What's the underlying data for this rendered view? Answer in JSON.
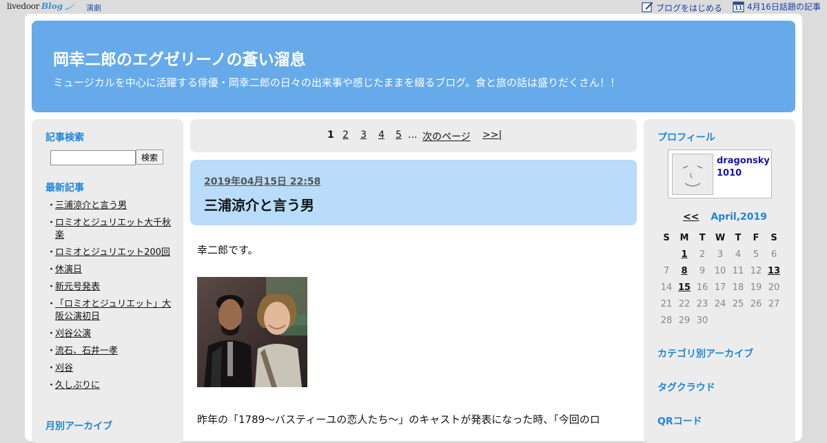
{
  "topbar": {
    "logo_text": "livedoor",
    "logo_blog": "Blog",
    "category": "演劇",
    "start_blog": "ブログをはじめる",
    "trending": "4月16日話題の記事",
    "calendar_icon_day": "11"
  },
  "header": {
    "title": "岡幸二郎のエグゼリーノの蒼い溜息",
    "subtitle": "ミュージカルを中心に活躍する俳優・岡幸二郎の日々の出来事や感じたままを綴るブログ。食と旅の話は盛りだくさん！！"
  },
  "sidebar_left": {
    "search_heading": "記事検索",
    "search_value": "",
    "search_button": "検索",
    "recent_heading": "最新記事",
    "recent": [
      {
        "label": "三浦涼介と言う男"
      },
      {
        "label": "ロミオとジュリエット大千秋楽"
      },
      {
        "label": "ロミオとジュリエット200回"
      },
      {
        "label": "休演日"
      },
      {
        "label": "新元号発表"
      },
      {
        "label": "「ロミオとジュリエット」大阪公演初日"
      },
      {
        "label": "刈谷公演"
      },
      {
        "label": "流石、石井一孝"
      },
      {
        "label": "刈谷"
      },
      {
        "label": "久しぶりに"
      }
    ],
    "monthly_heading": "月別アーカイブ"
  },
  "pager": {
    "current": "1",
    "pages": [
      "2",
      "3",
      "4",
      "5"
    ],
    "ellipsis": "...",
    "next": "次のページ",
    "last": ">>|"
  },
  "post": {
    "date": "2019年04月15日 22:58",
    "title": "三浦涼介と言う男",
    "greeting": "幸二郎です。",
    "paragraph": "昨年の「1789〜バスティーユの恋人たち〜」のキャストが発表になった時、「今回のロ"
  },
  "sidebar_right": {
    "profile_heading": "プロフィール",
    "profile_name": "dragonsky1010",
    "calendar": {
      "prev": "<<",
      "month": "April,2019",
      "weekdays": [
        "S",
        "M",
        "T",
        "W",
        "T",
        "F",
        "S"
      ],
      "weeks": [
        [
          "",
          "1",
          "2",
          "3",
          "4",
          "5",
          "6"
        ],
        [
          "7",
          "8",
          "9",
          "10",
          "11",
          "12",
          "13"
        ],
        [
          "14",
          "15",
          "16",
          "17",
          "18",
          "19",
          "20"
        ],
        [
          "21",
          "22",
          "23",
          "24",
          "25",
          "26",
          "27"
        ],
        [
          "28",
          "29",
          "30",
          "",
          "",
          "",
          ""
        ]
      ],
      "linked_days": [
        "1",
        "8",
        "13",
        "15"
      ]
    },
    "category_heading": "カテゴリ別アーカイブ",
    "tag_heading": "タグクラウド",
    "qr_heading": "QRコード"
  },
  "colors": {
    "header_bg": "#66aaea",
    "post_header_bg": "#b8dcfa",
    "sidebar_heading": "#1f86d6",
    "page_bg": "#dcdcdc"
  }
}
